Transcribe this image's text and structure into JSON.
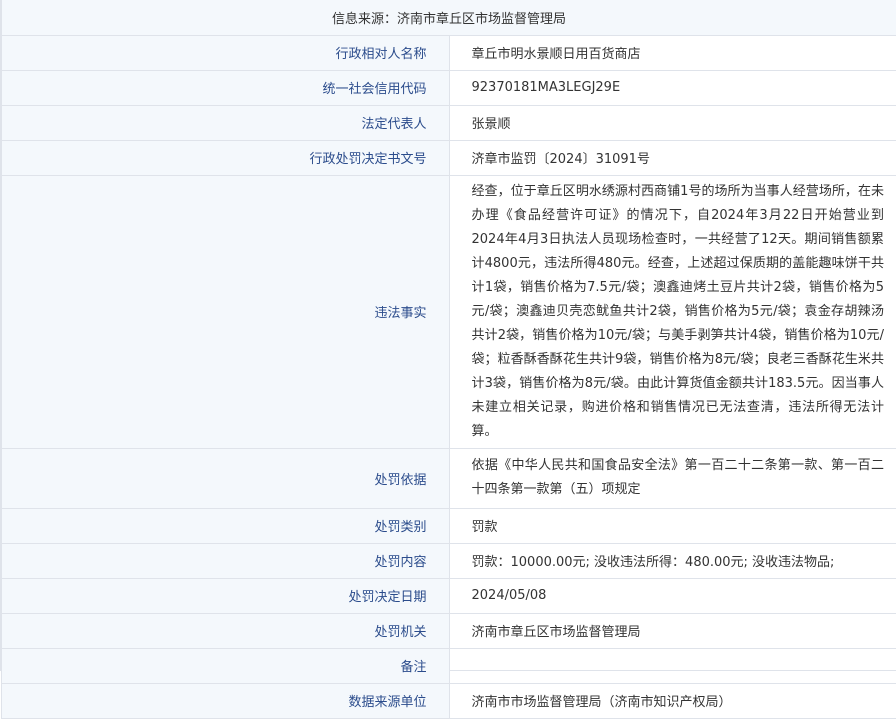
{
  "header": "信息来源：济南市章丘区市场监督管理局",
  "rows": [
    {
      "label": "行政相对人名称",
      "value": "章丘市明水景顺日用百货商店"
    },
    {
      "label": "统一社会信用代码",
      "value": "92370181MA3LEGJ29E"
    },
    {
      "label": "法定代表人",
      "value": "张景顺"
    },
    {
      "label": "行政处罚决定书文号",
      "value": "济章市监罚〔2024〕31091号"
    },
    {
      "label": "违法事实",
      "value": "经查，位于章丘区明水绣源村西商铺1号的场所为当事人经营场所，在未办理《食品经营许可证》的情况下，自2024年3月22日开始营业到2024年4月3日执法人员现场检查时，一共经营了12天。期间销售额累计4800元，违法所得480元。经查，上述超过保质期的盖能趣味饼干共计1袋，销售价格为7.5元/袋；澳鑫迪烤土豆片共计2袋，销售价格为5元/袋；澳鑫迪贝壳恋鱿鱼共计2袋，销售价格为5元/袋；袁金存胡辣汤共计2袋，销售价格为10元/袋；与美手剥笋共计4袋，销售价格为10元/袋；粒香酥香酥花生共计9袋，销售价格为8元/袋；良老三香酥花生米共计3袋，销售价格为8元/袋。由此计算货值金额共计183.5元。因当事人未建立相关记录，购进价格和销售情况已无法查清，违法所得无法计算。"
    },
    {
      "label": "处罚依据",
      "value": "依据《中华人民共和国食品安全法》第一百二十二条第一款、第一百二十四条第一款第（五）项规定"
    },
    {
      "label": "处罚类别",
      "value": "罚款"
    },
    {
      "label": "处罚内容",
      "value": "罚款：10000.00元; 没收违法所得：480.00元; 没收违法物品;"
    },
    {
      "label": "处罚决定日期",
      "value": "2024/05/08"
    },
    {
      "label": "处罚机关",
      "value": "济南市章丘区市场监督管理局"
    },
    {
      "label": "备注",
      "value": ""
    },
    {
      "label": "数据来源单位",
      "value": "济南市市场监督管理局（济南市知识产权局）"
    }
  ]
}
